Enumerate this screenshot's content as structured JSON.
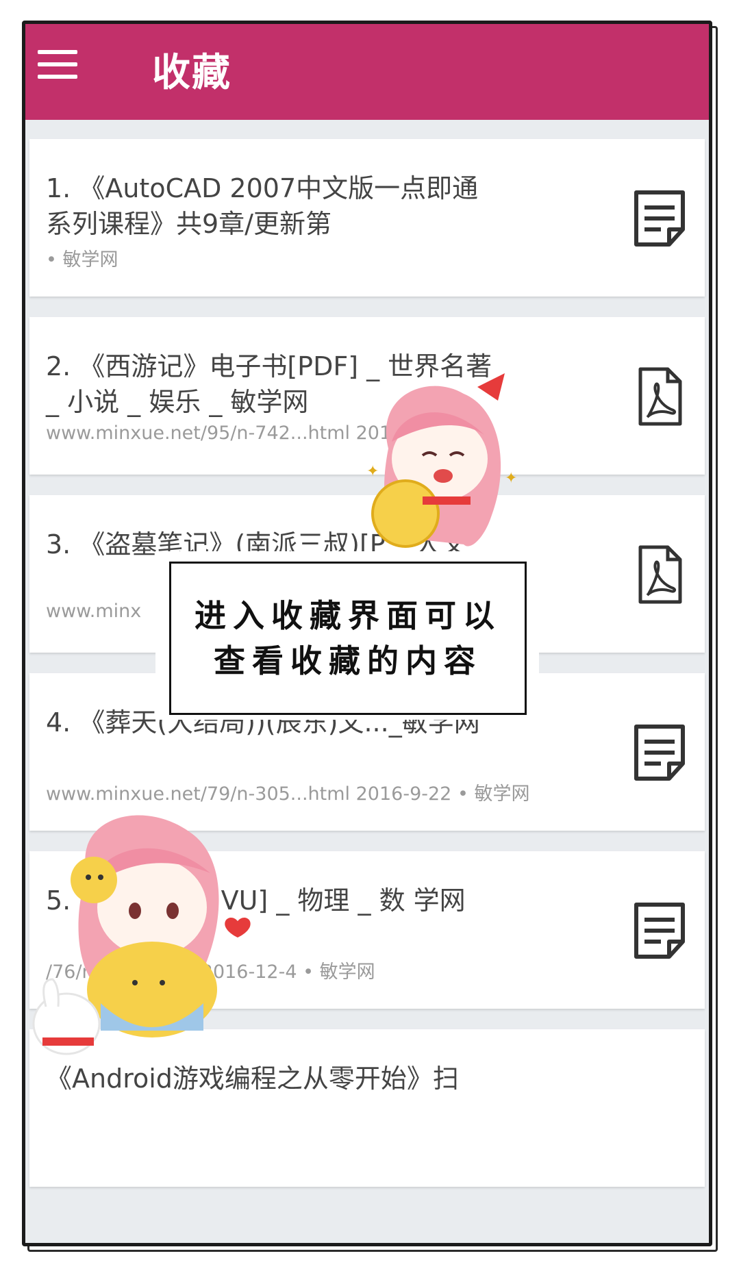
{
  "app": {
    "title": "收藏",
    "accent": "#c2306a"
  },
  "items": [
    {
      "title": "1. 《AutoCAD 2007中文版一点即通系列课程》共9章/更新第",
      "meta": "• 敏学网",
      "icon": "note-icon"
    },
    {
      "title": "2. 《西游记》电子书[PDF] _ 世界名著 _ 小说 _ 娱乐 _ 敏学网",
      "meta": "www.minxue.net/95/n-742...html 2017-",
      "icon": "pdf-icon"
    },
    {
      "title": "3. 《盗墓笔记》(南派三叔)[P _ 人文 _",
      "meta": "www.minx",
      "icon": "pdf-icon"
    },
    {
      "title": "4. 《葬天(大结局))(辰东)文..._敏学网",
      "meta": "www.minxue.net/79/n-305...html 2016-9-22 • 敏学网",
      "icon": "note-icon"
    },
    {
      "title": "5. 》扫描版[DJVU] _ 物理 _ 数 学网",
      "meta": "/76/n-537...html 2016-12-4 • 敏学网",
      "icon": "note-icon"
    },
    {
      "title": "《Android游戏编程之从零开始》扫",
      "meta": "",
      "icon": ""
    }
  ],
  "caption": {
    "line1": "进入收藏界面可以",
    "line2": "查看收藏的内容"
  }
}
